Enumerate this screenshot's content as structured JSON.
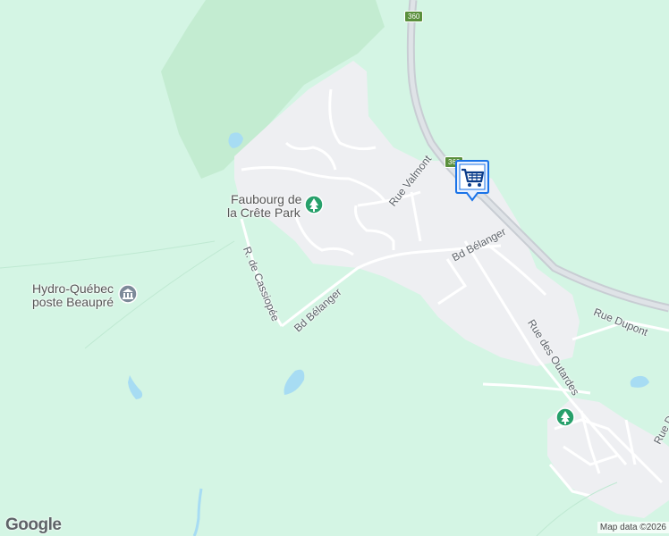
{
  "map": {
    "colors": {
      "background": "#d4f5e4",
      "forest": "#c3ecd1",
      "urban": "#eeeff2",
      "road": "#ffffff",
      "highway": "#c8cdd3",
      "water": "#a7dcf3",
      "park_icon": "#27a06b",
      "poi_icon": "#7d8a99",
      "shopping_pin": "#1a73e8"
    },
    "route_shields": [
      "360",
      "360"
    ],
    "streets": {
      "rue_valmont": "Rue Valmont",
      "bd_belanger_east": "Bd Bélanger",
      "bd_belanger_west": "Bd Bélanger",
      "r_de_cassiopee": "R. de Cassiopée",
      "rue_des_outardes": "Rue des Outardes",
      "rue_dupont": "Rue Dupont",
      "rue_du_partial": "Rue Du"
    },
    "places": {
      "park_line1": "Faubourg de",
      "park_line2": "la Crête Park",
      "hydro_line1": "Hydro-Québec",
      "hydro_line2": "poste Beaupré"
    },
    "icons": {
      "park": "tree-icon",
      "park_south": "tree-icon",
      "hydro": "government-building-icon",
      "shopping": "shopping-cart-icon"
    },
    "footer": {
      "logo": "Google",
      "attribution": "Map data ©2026"
    }
  }
}
